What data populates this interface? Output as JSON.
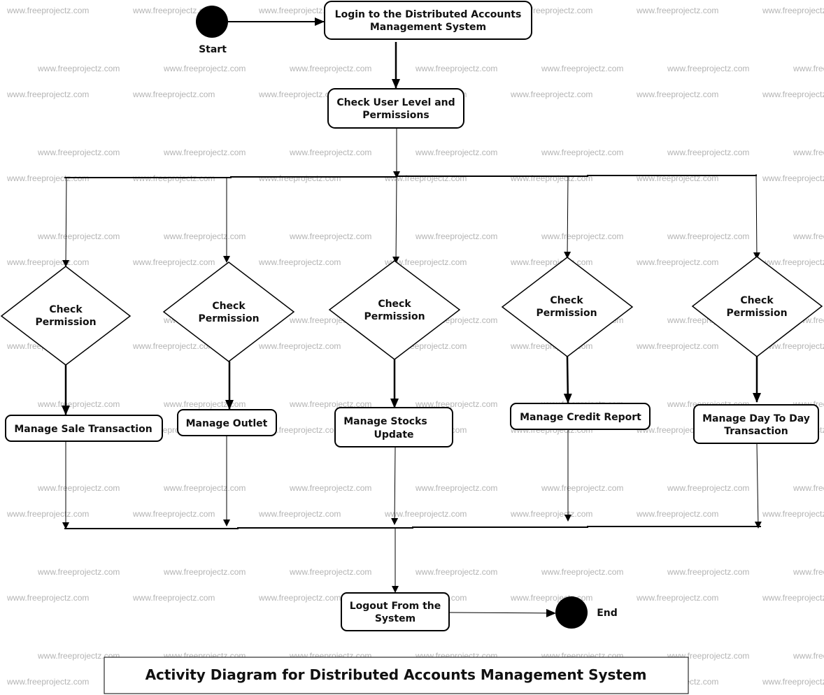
{
  "title": "Activity Diagram for Distributed Accounts Management System",
  "watermark": "www.freeprojectz.com",
  "start": {
    "label": "Start"
  },
  "end": {
    "label": "End"
  },
  "nodes": {
    "login": [
      "Login to the Distributed Accounts",
      "Management System"
    ],
    "check_user": [
      "Check User Level and",
      "Permissions"
    ],
    "logout": [
      "Logout From the",
      "System"
    ]
  },
  "branches": [
    {
      "decision": [
        "Check",
        "Permission"
      ],
      "activity": [
        "Manage Sale Transaction"
      ]
    },
    {
      "decision": [
        "Check",
        "Permission"
      ],
      "activity": [
        "Manage Outlet"
      ]
    },
    {
      "decision": [
        "Check",
        "Permission"
      ],
      "activity": [
        "Manage Stocks",
        "Update"
      ]
    },
    {
      "decision": [
        "Check",
        "Permission"
      ],
      "activity": [
        "Manage Credit Report"
      ]
    },
    {
      "decision": [
        "Check",
        "Permission"
      ],
      "activity": [
        "Manage Day To Day",
        "Transaction"
      ]
    }
  ],
  "colors": {
    "stroke": "#000000",
    "watermark": "#b4b4b4",
    "background": "#ffffff"
  }
}
